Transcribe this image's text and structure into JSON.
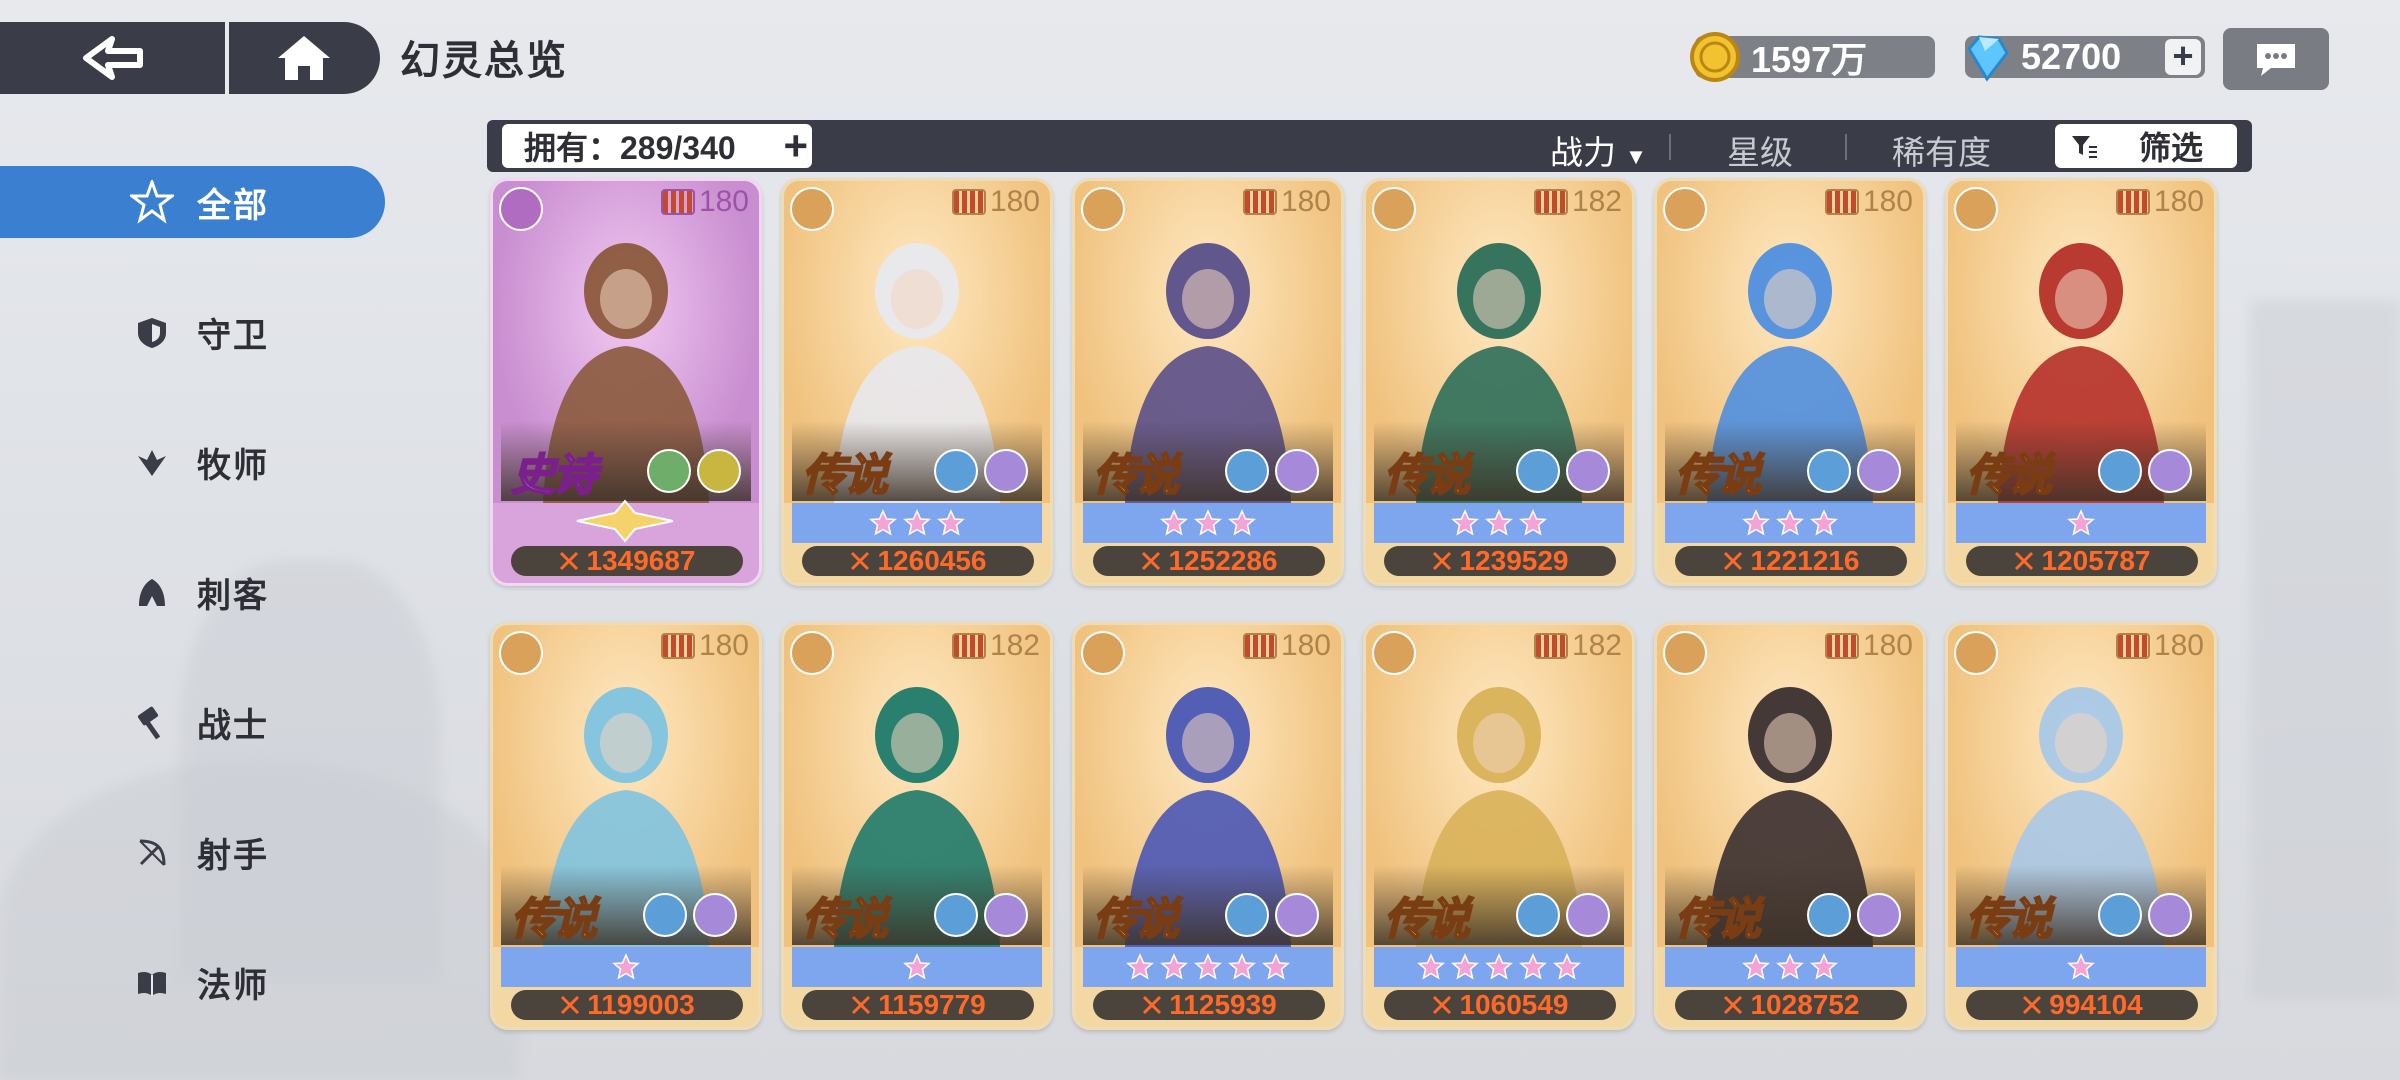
{
  "header": {
    "title": "幻灵总览",
    "coins": "1597万",
    "gems": "52700"
  },
  "sidebar": {
    "items": [
      {
        "label": "全部",
        "icon": "all-star-icon",
        "active": true
      },
      {
        "label": "守卫",
        "icon": "shield-icon",
        "active": false
      },
      {
        "label": "牧师",
        "icon": "priest-wings-icon",
        "active": false
      },
      {
        "label": "刺客",
        "icon": "assassin-hood-icon",
        "active": false
      },
      {
        "label": "战士",
        "icon": "hammer-icon",
        "active": false
      },
      {
        "label": "射手",
        "icon": "bow-icon",
        "active": false
      },
      {
        "label": "法师",
        "icon": "book-icon",
        "active": false
      }
    ]
  },
  "filterbar": {
    "owned": "拥有：289/340",
    "sort_power": "战力",
    "sort_star": "星级",
    "sort_rarity": "稀有度",
    "filter": "筛选"
  },
  "cards": [
    {
      "rarity": "史诗",
      "level": "180",
      "stars": 0,
      "power": "1349687",
      "class": "bow-icon",
      "tier": "epic",
      "palette": "#8b5a3c"
    },
    {
      "rarity": "传说",
      "level": "180",
      "stars": 3,
      "power": "1260456",
      "class": "bow-icon",
      "tier": "legend",
      "palette": "#e8e8ee"
    },
    {
      "rarity": "传说",
      "level": "180",
      "stars": 3,
      "power": "1252286",
      "class": "assassin-hood-icon",
      "tier": "legend",
      "palette": "#5a4f8a"
    },
    {
      "rarity": "传说",
      "level": "182",
      "stars": 3,
      "power": "1239529",
      "class": "hammer-icon",
      "tier": "legend",
      "palette": "#2c6e5a"
    },
    {
      "rarity": "传说",
      "level": "180",
      "stars": 3,
      "power": "1221216",
      "class": "shield-icon",
      "tier": "legend",
      "palette": "#4f8fe0"
    },
    {
      "rarity": "传说",
      "level": "180",
      "stars": 1,
      "power": "1205787",
      "class": "book-icon",
      "tier": "legend",
      "palette": "#b5302a"
    },
    {
      "rarity": "传说",
      "level": "180",
      "stars": 1,
      "power": "1199003",
      "class": "shield-icon",
      "tier": "legend",
      "palette": "#7fc3e0"
    },
    {
      "rarity": "传说",
      "level": "182",
      "stars": 1,
      "power": "1159779",
      "class": "hammer-icon",
      "tier": "legend",
      "palette": "#1f7a6b"
    },
    {
      "rarity": "传说",
      "level": "180",
      "stars": 5,
      "power": "1125939",
      "class": "priest-wings-icon",
      "tier": "legend",
      "palette": "#4a56b5"
    },
    {
      "rarity": "传说",
      "level": "182",
      "stars": 5,
      "power": "1060549",
      "class": "hammer-icon",
      "tier": "legend",
      "palette": "#d9b15a"
    },
    {
      "rarity": "传说",
      "level": "180",
      "stars": 3,
      "power": "1028752",
      "class": "book-icon",
      "tier": "legend",
      "palette": "#3a2f30"
    },
    {
      "rarity": "传说",
      "level": "180",
      "stars": 1,
      "power": "994104",
      "class": "book-icon",
      "tier": "legend",
      "palette": "#a9c8e8"
    }
  ],
  "colors": {
    "accent": "#3a7fd0",
    "bar": "#3a3c47",
    "legend_card": "#f3d8a3",
    "epic_card": "#d9a3dc",
    "star_row": "#7ea6ef",
    "power_text": "#ff6a2a"
  }
}
